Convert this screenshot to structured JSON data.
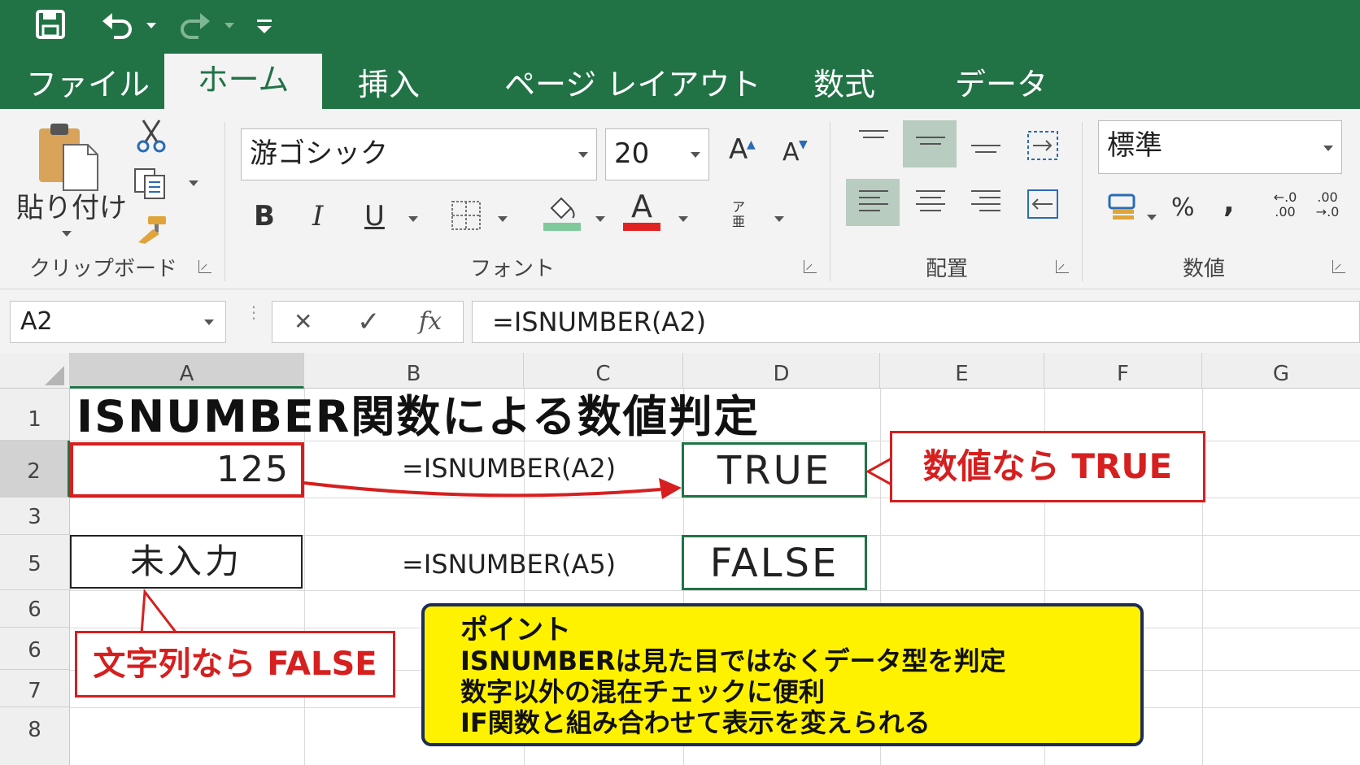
{
  "ribbon_tabs": [
    {
      "label": "ファイル",
      "active": false
    },
    {
      "label": "ホーム",
      "active": true
    },
    {
      "label": "挿入",
      "active": false
    },
    {
      "label": "ページ レイアウト",
      "active": false
    },
    {
      "label": "数式",
      "active": false
    },
    {
      "label": "データ",
      "active": false
    }
  ],
  "clipboard": {
    "paste_label": "貼り付け",
    "group_label": "クリップボード"
  },
  "font": {
    "name": "游ゴシック",
    "size": "20",
    "group_label": "フォント",
    "bold": "B",
    "italic": "I",
    "underline": "U",
    "font_color_glyph": "A",
    "grow_glyph": "A",
    "shrink_glyph": "A",
    "phonetic_glyph": "ア亜"
  },
  "alignment": {
    "group_label": "配置"
  },
  "number": {
    "format": "標準",
    "group_label": "数値",
    "percent": "%",
    "comma": ",",
    "inc_decimal": "←.0\n.00",
    "dec_decimal": ".00\n→.0"
  },
  "formula_bar": {
    "name_box": "A2",
    "cancel": "✕",
    "enter": "✓",
    "fx": "fx",
    "formula": "=ISNUMBER(A2)"
  },
  "columns": [
    "A",
    "B",
    "C",
    "D",
    "E",
    "F",
    "G"
  ],
  "rows": [
    "1",
    "2",
    "3",
    "5",
    "6",
    "6",
    "7",
    "8"
  ],
  "cells": {
    "title": "ISNUMBER関数による数値判定",
    "a2": "125",
    "b2": "=ISNUMBER(A2)",
    "d2": "TRUE",
    "a5": "未入力",
    "b5": "=ISNUMBER(A5)",
    "d5": "FALSE"
  },
  "callouts": {
    "true_note": "数値なら TRUE",
    "false_note": "文字列なら FALSE"
  },
  "point": {
    "heading": "ポイント",
    "lines": [
      "ISNUMBERは見た目ではなくデータ型を判定",
      "数字以外の混在チェックに便利",
      "IF関数と組み合わせて表示を変えられる"
    ]
  },
  "colors": {
    "excel_green": "#217346",
    "red": "#d61f1f",
    "yellow": "#fff200",
    "navy": "#1d2c5a"
  }
}
